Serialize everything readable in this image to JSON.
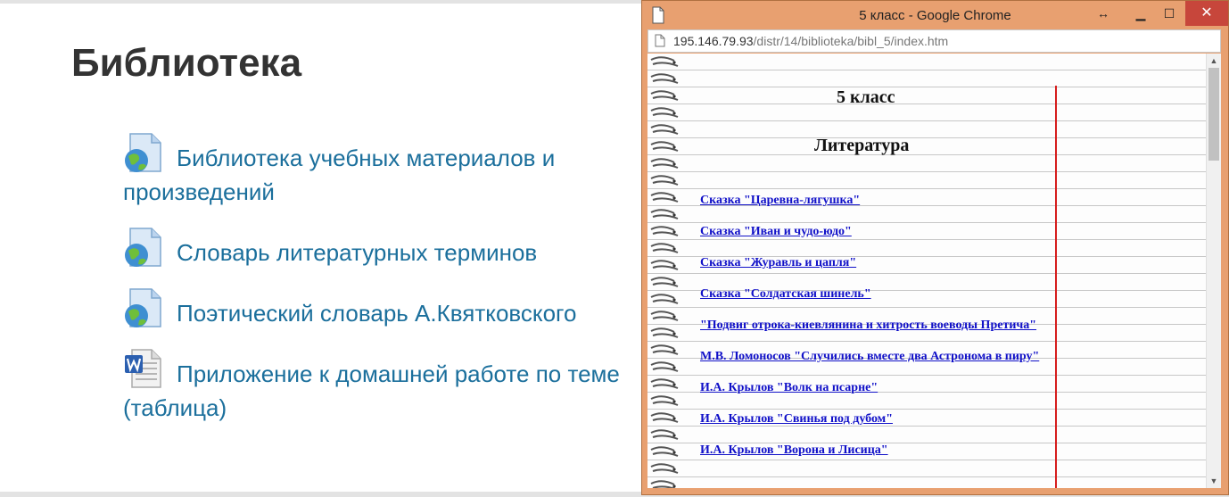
{
  "page": {
    "title": "Библиотека",
    "resources": [
      {
        "label": "Библиотека учебных материалов и произведений",
        "icon": "web-page-icon"
      },
      {
        "label": "Словарь литературных терминов",
        "icon": "web-page-icon"
      },
      {
        "label": "Поэтический словарь А.Квятковского",
        "icon": "web-page-icon"
      },
      {
        "label": "Приложение к домашней работе по теме (таблица)",
        "icon": "word-document-icon"
      }
    ]
  },
  "popup": {
    "window_title": "5 класс - Google Chrome",
    "address": {
      "host": "195.146.79.93",
      "path": "/distr/14/biblioteka/bibl_5/index.htm"
    },
    "doc": {
      "grade": "5 класс",
      "subject": "Литература",
      "items": [
        "Сказка \"Царевна-лягушка\"",
        "Сказка \"Иван и чудо-юдо\"",
        "Сказка \"Журавль и цапля\"",
        "Сказка \"Солдатская шинель\"",
        "\"Подвиг отрока-киевлянина и хитрость воеводы Претича\"",
        "М.В. Ломоносов \"Случились вместе два Астронома в пиру\"",
        "И.А. Крылов \"Волк на псарне\"",
        "И.А. Крылов \"Свинья под дубом\"",
        "И.А. Крылов \"Ворона и Лисица\""
      ]
    }
  },
  "colors": {
    "link": "#1b6f9c",
    "doc_link": "#1010c8",
    "margin_line": "#d61d1d",
    "window_frame": "#e8a070"
  }
}
